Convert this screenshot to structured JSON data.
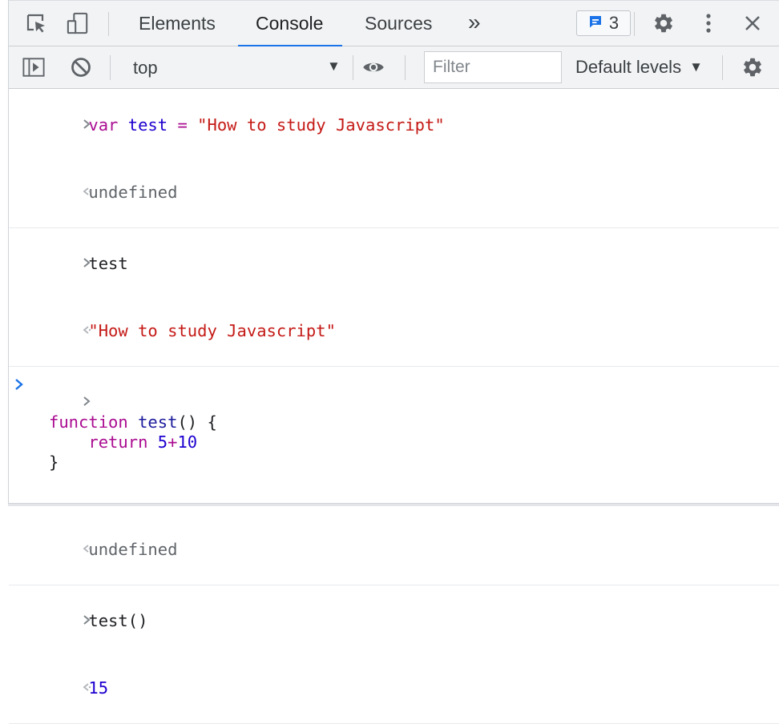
{
  "tabs": {
    "items": [
      {
        "label": "Elements"
      },
      {
        "label": "Console"
      },
      {
        "label": "Sources"
      }
    ],
    "more_label": "»",
    "issues_count": "3"
  },
  "toolbar": {
    "context": "top",
    "filter_placeholder": "Filter",
    "levels_label": "Default levels"
  },
  "console": {
    "entry1": {
      "kw": "var",
      "name": "test",
      "op": "=",
      "str": "\"How to study Javascript\"",
      "result": "undefined"
    },
    "entry2": {
      "input": "test",
      "result": "\"How to study Javascript\""
    },
    "entry3": {
      "kw": "function",
      "name": "test",
      "parens": "() {",
      "indent": "    ",
      "ret": "return",
      "n1": "5",
      "plus": "+",
      "n2": "10",
      "close": "}",
      "result": "undefined"
    },
    "entry4": {
      "input": "test()",
      "result": "15"
    }
  },
  "colors": {
    "accent": "#1a73e8",
    "keyword": "#aa0d91",
    "string": "#c41a16",
    "number": "#1c00cf"
  },
  "icons": [
    "inspect-element-icon",
    "device-toolbar-icon",
    "message-icon",
    "gear-icon",
    "more-vertical-icon",
    "close-icon",
    "sidebar-toggle-icon",
    "clear-console-icon",
    "eye-icon",
    "chevron-right-icon",
    "chevron-left-icon"
  ]
}
